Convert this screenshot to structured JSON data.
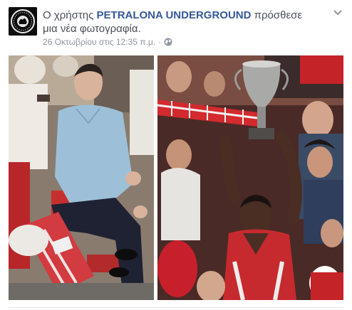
{
  "post": {
    "headline_prefix": "Ο χρήστης",
    "author": "PETRALONA UNDERGROUND",
    "action": "πρόσθεσε μια νέα φωτογραφία.",
    "timestamp": "26 Οκτωβρίου στις 12:35 π.μ.",
    "separator": "·",
    "privacy_icon": "globe-icon",
    "options_icon": "chevron-down-icon",
    "avatar_icon": "page-logo-icon",
    "link_color": "#365899",
    "meta_color": "#90949c"
  },
  "photos": [
    {
      "name": "photo-left",
      "subject": "man in blue shirt seated in stands"
    },
    {
      "name": "photo-right",
      "subject": "player raising trophy among fans"
    }
  ]
}
